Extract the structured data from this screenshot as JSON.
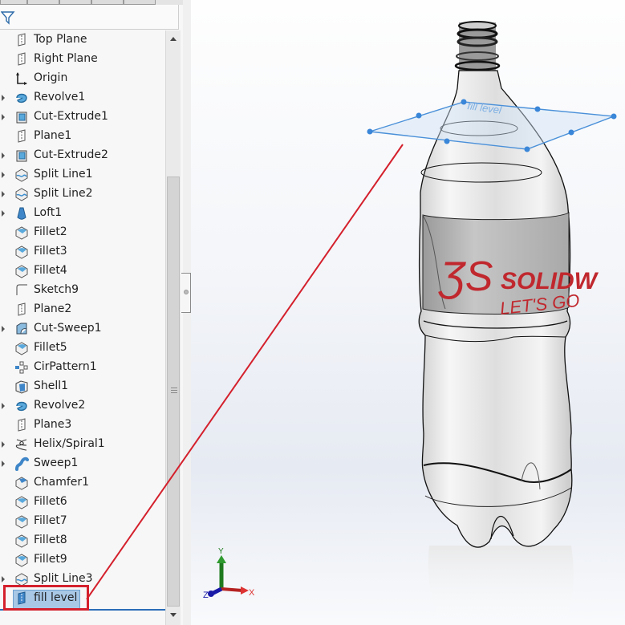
{
  "app": "SOLIDWORKS",
  "feature_manager": {
    "filter_icon": "filter-icon",
    "items": [
      {
        "label": "Top Plane",
        "icon": "plane-icon",
        "expandable": false
      },
      {
        "label": "Right Plane",
        "icon": "plane-icon",
        "expandable": false
      },
      {
        "label": "Origin",
        "icon": "origin-icon",
        "expandable": false
      },
      {
        "label": "Revolve1",
        "icon": "revolve-icon",
        "expandable": true
      },
      {
        "label": "Cut-Extrude1",
        "icon": "cut-extrude-icon",
        "expandable": true
      },
      {
        "label": "Plane1",
        "icon": "plane-icon",
        "expandable": false
      },
      {
        "label": "Cut-Extrude2",
        "icon": "cut-extrude-icon",
        "expandable": true
      },
      {
        "label": "Split Line1",
        "icon": "split-line-icon",
        "expandable": true
      },
      {
        "label": "Split Line2",
        "icon": "split-line-icon",
        "expandable": true
      },
      {
        "label": "Loft1",
        "icon": "loft-icon",
        "expandable": true
      },
      {
        "label": "Fillet2",
        "icon": "fillet-icon",
        "expandable": false
      },
      {
        "label": "Fillet3",
        "icon": "fillet-icon",
        "expandable": false
      },
      {
        "label": "Fillet4",
        "icon": "fillet-icon",
        "expandable": false
      },
      {
        "label": "Sketch9",
        "icon": "sketch-icon",
        "expandable": false
      },
      {
        "label": "Plane2",
        "icon": "plane-icon",
        "expandable": false
      },
      {
        "label": "Cut-Sweep1",
        "icon": "cut-sweep-icon",
        "expandable": true
      },
      {
        "label": "Fillet5",
        "icon": "fillet-icon",
        "expandable": false
      },
      {
        "label": "CirPattern1",
        "icon": "circular-pattern-icon",
        "expandable": false
      },
      {
        "label": "Shell1",
        "icon": "shell-icon",
        "expandable": false
      },
      {
        "label": "Revolve2",
        "icon": "revolve-icon",
        "expandable": true
      },
      {
        "label": "Plane3",
        "icon": "plane-icon",
        "expandable": false
      },
      {
        "label": "Helix/Spiral1",
        "icon": "helix-icon",
        "expandable": true
      },
      {
        "label": "Sweep1",
        "icon": "sweep-icon",
        "expandable": true
      },
      {
        "label": "Chamfer1",
        "icon": "chamfer-icon",
        "expandable": false
      },
      {
        "label": "Fillet6",
        "icon": "fillet-icon",
        "expandable": false
      },
      {
        "label": "Fillet7",
        "icon": "fillet-icon",
        "expandable": false
      },
      {
        "label": "Fillet8",
        "icon": "fillet-icon",
        "expandable": false
      },
      {
        "label": "Fillet9",
        "icon": "fillet-icon",
        "expandable": false
      },
      {
        "label": "Split Line3",
        "icon": "split-line-icon",
        "expandable": true
      },
      {
        "label": "fill level",
        "icon": "plane-icon",
        "expandable": false,
        "selected": true
      }
    ]
  },
  "viewport": {
    "plane_label": "fill level",
    "label_brand": "SOLIDW",
    "label_tagline": "LET'S GO",
    "triad": {
      "x": "X",
      "y": "Y",
      "z": "Z"
    }
  },
  "colors": {
    "accent_blue": "#4a90d9",
    "highlight_red": "#d4202c",
    "selection": "#a8c8e6",
    "brand_red": "#c0282e"
  }
}
